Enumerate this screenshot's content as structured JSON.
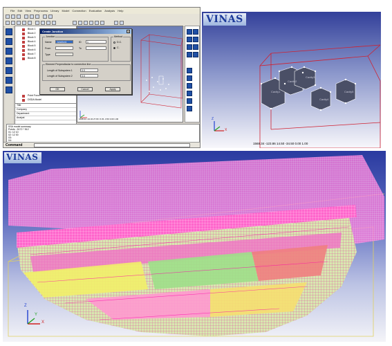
{
  "app": {
    "menu": [
      "File",
      "Edit",
      "View",
      "Preprocess",
      "Library",
      "Model",
      "Connection",
      "Evaluation",
      "Analysis",
      "Help"
    ],
    "tree_items": [
      "Block 1",
      "Block 2",
      "Block 3",
      "Block 4",
      "Block 5",
      "Block 6",
      "Block 7",
      "Block 8",
      "Point Force",
      "DSDA Model"
    ],
    "props_rows": [
      "Title",
      "Company",
      "Department",
      "Analyst"
    ],
    "output_lines": [
      "SSA model summary",
      "Points : 5172 * 512",
      "01: 12 10",
      "02: 12 00",
      "03:",
      "04:"
    ],
    "viewport_readout": "1568.44 -34.34 27.83 -5.33 -3.50 0.00 1.00",
    "command_label": "Command",
    "command_value": ""
  },
  "dialog": {
    "title": "Create Junction",
    "junction_group": "Junction",
    "name_label": "Name",
    "name_value": "Junction1",
    "id_label": "ID",
    "id_value": "1",
    "from_label": "From",
    "to_label": "To",
    "type_label": "Type",
    "method_group": "Method",
    "method_options": [
      "D.C.",
      "C."
    ],
    "method_selected": 1,
    "element_group": "Element Perpendicular to connection line",
    "len1_label": "Length of Subsystem 1",
    "len1_value": "0.0",
    "len2_label": "Length of Subsystem 2",
    "len2_value": "0.0",
    "ok_label": "OK",
    "cancel_label": "Cancel",
    "apply_label": "Apply"
  },
  "view3d": {
    "logo": "VINAS",
    "boxes": [
      "Cavity1",
      "Cavity2",
      "Cavity3",
      "Cavity4",
      "Cavity5"
    ],
    "coordinate_readout": "1568.34 -123.86 14.50 -34.50 0.00 1.00"
  },
  "ship_view": {
    "logo": "VINAS"
  },
  "axes": {
    "x": "X",
    "y": "Y",
    "z": "Z"
  }
}
